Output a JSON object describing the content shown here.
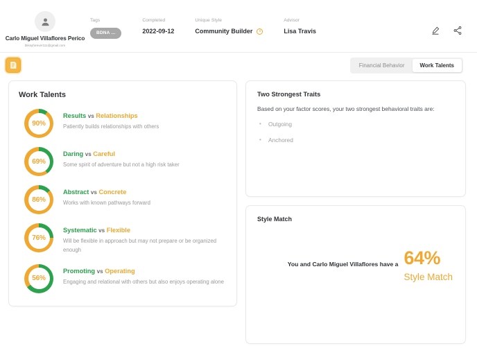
{
  "header": {
    "profile": {
      "name": "Carlo Miguel Villaflores Perico",
      "email": "blissyforever111@gmail.com",
      "avatar_icon": "user-icon"
    },
    "fields": [
      {
        "label": "Tags",
        "value": "BDNA ...",
        "type": "tag"
      },
      {
        "label": "Completed",
        "value": "2022-09-12",
        "type": "text"
      },
      {
        "label": "Unique Style",
        "value": "Community Builder",
        "type": "text-info"
      },
      {
        "label": "Advisor",
        "value": "Lisa Travis",
        "type": "text"
      }
    ],
    "actions": [
      {
        "name": "edit-icon",
        "title": "Edit"
      },
      {
        "name": "share-icon",
        "title": "Share"
      }
    ]
  },
  "tabbar": {
    "badge_button": {
      "icon": "report-badge-icon",
      "color": "#f5b642"
    },
    "tabs": [
      {
        "label": "Financial Behavior",
        "active": false
      },
      {
        "label": "Work Talents",
        "active": true
      }
    ]
  },
  "work_talents": {
    "title": "Work Talents",
    "items": [
      {
        "percent": "90",
        "percent_symbol": "%",
        "green_ratio": 10,
        "left_label": "Results",
        "vs": "vs",
        "right_label": "Relationships",
        "description": "Patiently builds relationships with others"
      },
      {
        "percent": "69",
        "percent_symbol": "%",
        "green_ratio": 40,
        "left_label": "Daring",
        "vs": "vs",
        "right_label": "Careful",
        "description": "Some spirit of adventure but not a high risk taker"
      },
      {
        "percent": "86",
        "percent_symbol": "%",
        "green_ratio": 14,
        "left_label": "Abstract",
        "vs": "vs",
        "right_label": "Concrete",
        "description": "Works with known pathways forward"
      },
      {
        "percent": "76",
        "percent_symbol": "%",
        "green_ratio": 25,
        "left_label": "Systematic",
        "vs": "vs",
        "right_label": "Flexible",
        "description": "Will be flexible in approach but may not prepare or be organized enough"
      },
      {
        "percent": "56",
        "percent_symbol": "%",
        "green_ratio": 65,
        "left_label": "Promoting",
        "vs": "vs",
        "right_label": "Operating",
        "description": "Engaging and relational with others but also enjoys operating alone"
      }
    ]
  },
  "strongest_traits": {
    "title": "Two Strongest Traits",
    "lead": "Based on your factor scores, your two strongest behavioral traits are:",
    "items": [
      "Outgoing",
      "Anchored"
    ]
  },
  "style_match": {
    "title": "Style Match",
    "sentence": "You and Carlo Miguel Villaflores have a",
    "percent": "64%",
    "label": "Style Match"
  },
  "colors": {
    "orange": "#f0a830",
    "green": "#2ba24c",
    "tag_gray": "#a8a8a8",
    "text_dark": "#2f3134",
    "text_muted": "#9a9a9a"
  }
}
